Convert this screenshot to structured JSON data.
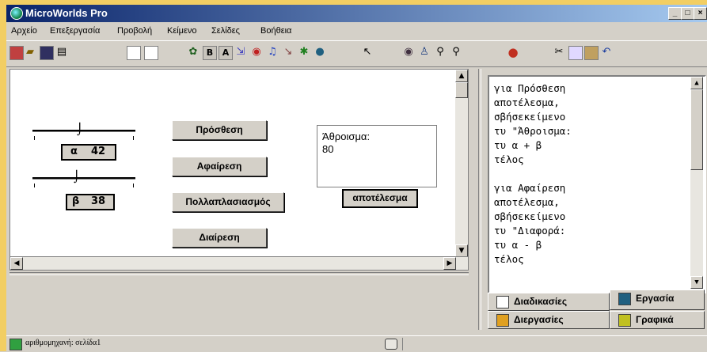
{
  "window": {
    "title": "MicroWorlds Pro",
    "minimize": "_",
    "maximize": "□",
    "close": "×"
  },
  "menu": {
    "items": [
      "Αρχείο",
      "Επεξεργασία",
      "Προβολή",
      "Κείμενο",
      "Σελίδες",
      "Βοήθεια"
    ]
  },
  "sliders": {
    "a_label": "α",
    "a_value": "42",
    "b_label": "β",
    "b_value": "38"
  },
  "buttons": {
    "add": "Πρόσθεση",
    "subtract": "Αφαίρεση",
    "multiply": "Πολλαπλασιασμός",
    "divide": "Διαίρεση",
    "result": "αποτέλεσμα"
  },
  "result_box": {
    "label": "Άθροισμα:",
    "value": "80"
  },
  "procedures": {
    "lines": [
      "για Πρόσθεση",
      "αποτέλεσμα,",
      "σβήσεκείμενο",
      "τυ \"Άθροισμα:",
      "τυ α + β",
      "τέλος",
      "",
      "για Αφαίρεση",
      "αποτέλεσμα,",
      "σβήσεκείμενο",
      "τυ \"Διαφορά:",
      "τυ α - β",
      "τέλος"
    ]
  },
  "tabs": {
    "procedures": "Διαδικασίες",
    "project": "Εργασία",
    "processes": "Διεργασίες",
    "graphics": "Γραφικά"
  },
  "status": {
    "text": "αριθμομηχανή: σελίδα1"
  },
  "colors": {
    "title_start": "#0a246a",
    "title_end": "#a6caf0",
    "frame": "#f2ce63",
    "chrome": "#d4d0c8"
  }
}
